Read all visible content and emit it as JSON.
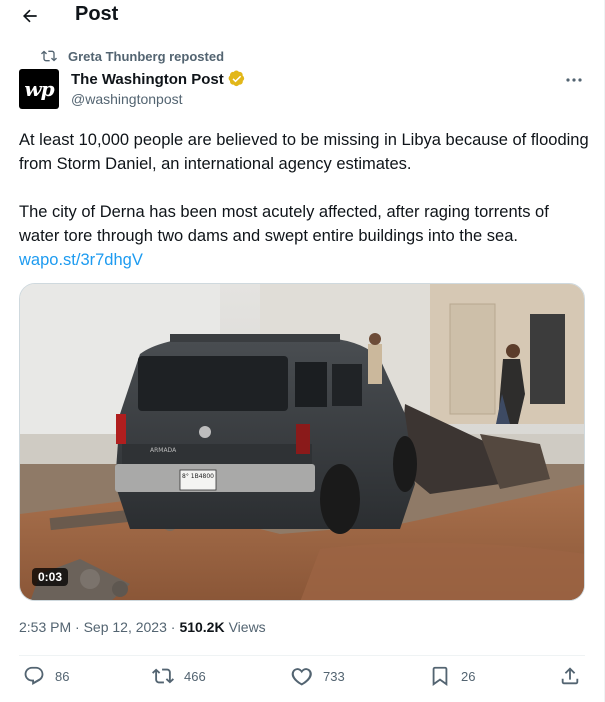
{
  "header": {
    "title": "Post",
    "back_icon": "arrow-left-icon"
  },
  "repost": {
    "label": "Greta Thunberg reposted",
    "icon": "repost-icon"
  },
  "author": {
    "avatar_text": "wp",
    "name": "The Washington Post",
    "verified_badge_color": "#e2b719",
    "handle": "@washingtonpost"
  },
  "tweet": {
    "paragraph1": "At least 10,000 people are believed to be missing in Libya because of flooding from Storm Daniel, an international agency estimates.",
    "paragraph2": "The city of Derna has been most acutely affected, after raging torrents of water tore through two dams and swept entire buildings into the sea.",
    "link": "wapo.st/3r7dhgV",
    "link_color": "#1d9bf0"
  },
  "media": {
    "duration": "0:03",
    "plate_text": "8° 1B4800",
    "vehicle_badge": "ARMADA"
  },
  "meta": {
    "time_date": "2:53 PM · Sep 12, 2023 ·",
    "views_count": "510.2K",
    "views_label": "Views"
  },
  "actions": {
    "replies": "86",
    "reposts": "466",
    "likes": "733",
    "bookmarks": "26"
  }
}
